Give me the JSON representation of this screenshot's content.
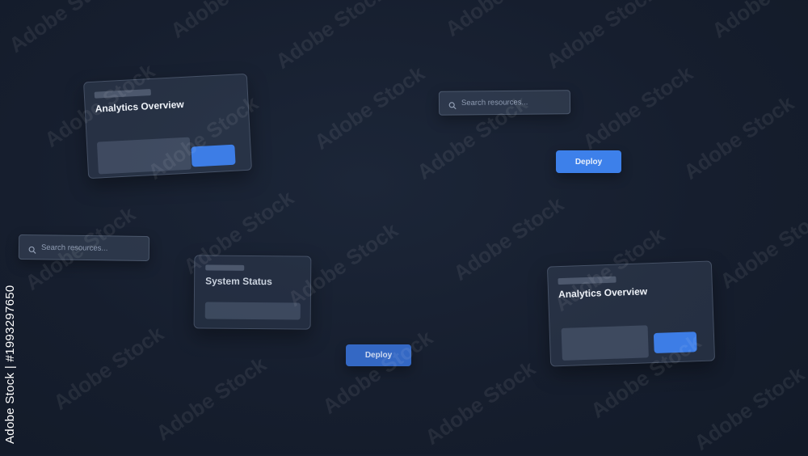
{
  "cards": [
    {
      "title": "Analytics Overview"
    },
    {
      "title": "System Status"
    },
    {
      "title": "Analytics Overview"
    }
  ],
  "search": {
    "placeholder": "Search resources..."
  },
  "deploy_label": "Deploy",
  "watermark": {
    "text": "Adobe Stock"
  },
  "side_id": "Adobe Stock | #1993297650",
  "colors": {
    "background": "#161e2e",
    "accent": "#3d7de6"
  }
}
